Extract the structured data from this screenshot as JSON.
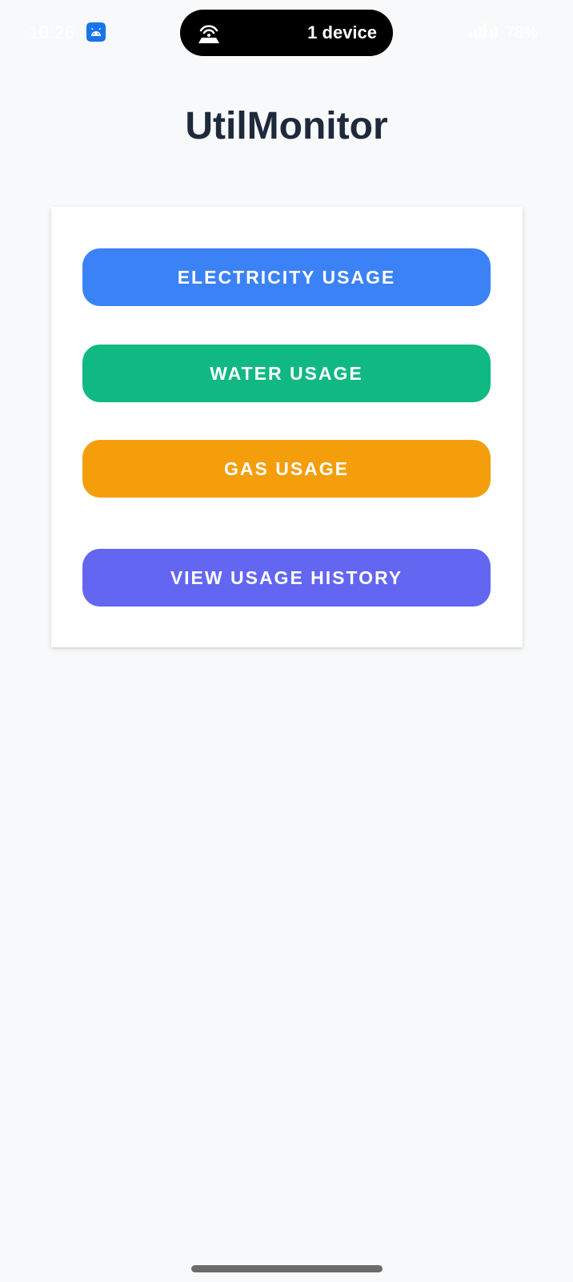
{
  "status_bar": {
    "time": "10:26",
    "island_text": "1 device",
    "battery": "78%"
  },
  "app": {
    "title": "UtilMonitor"
  },
  "buttons": {
    "electricity": {
      "label": "ELECTRICITY USAGE",
      "color": "#3b82f6"
    },
    "water": {
      "label": "WATER USAGE",
      "color": "#10b981"
    },
    "gas": {
      "label": "GAS USAGE",
      "color": "#f59e0b"
    },
    "history": {
      "label": "VIEW USAGE HISTORY",
      "color": "#6366f1"
    }
  },
  "colors": {
    "background": "#f8f9fb",
    "title": "#1e293b",
    "card": "#ffffff"
  }
}
